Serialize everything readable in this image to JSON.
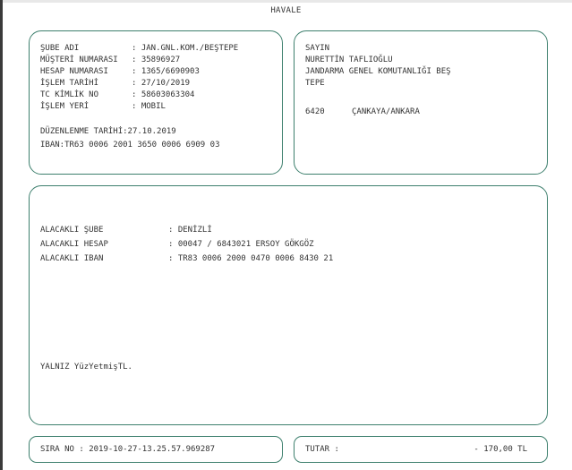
{
  "title": "HAVALE",
  "sender": {
    "rows": [
      {
        "label": "ŞUBE ADI",
        "value": "JAN.GNL.KOM./BEŞTEPE"
      },
      {
        "label": "MÜŞTERİ NUMARASI",
        "value": "35896927"
      },
      {
        "label": "HESAP NUMARASI",
        "value": "1365/6690903"
      },
      {
        "label": "İŞLEM TARİHİ",
        "value": "27/10/2019"
      },
      {
        "label": "TC KİMLİK NO",
        "value": "58603063304"
      },
      {
        "label": "İŞLEM YERİ",
        "value": "MOBIL"
      }
    ],
    "issue_date": "DÜZENLENME TARİHİ:27.10.2019",
    "iban": "IBAN:TR63 0006 2001 3650 0006 6909 03"
  },
  "recipient": {
    "salutation": "SAYIN",
    "name": "NURETTİN TAFLIOĞLU",
    "org": "JANDARMA GENEL KOMUTANLIĞI BEŞ",
    "org_cont": "TEPE",
    "postal_code": "6420",
    "district": "ÇANKAYA/ANKARA"
  },
  "beneficiary": {
    "rows": [
      {
        "label": "ALACAKLI ŞUBE",
        "value": "DENİZLİ"
      },
      {
        "label": "ALACAKLI HESAP",
        "value": "00047 / 6843021 ERSOY GÖKGÖZ"
      },
      {
        "label": "ALACAKLI IBAN",
        "value": "TR83 0006 2000 0470 0006 8430 21"
      }
    ],
    "amount_in_words": "YALNIZ YüzYetmişTL."
  },
  "footer": {
    "sequence_label": "SIRA NO :",
    "sequence_value": "2019-10-27-13.25.57.969287",
    "total_label": "TUTAR :",
    "total_value": "- 170,00 TL"
  }
}
